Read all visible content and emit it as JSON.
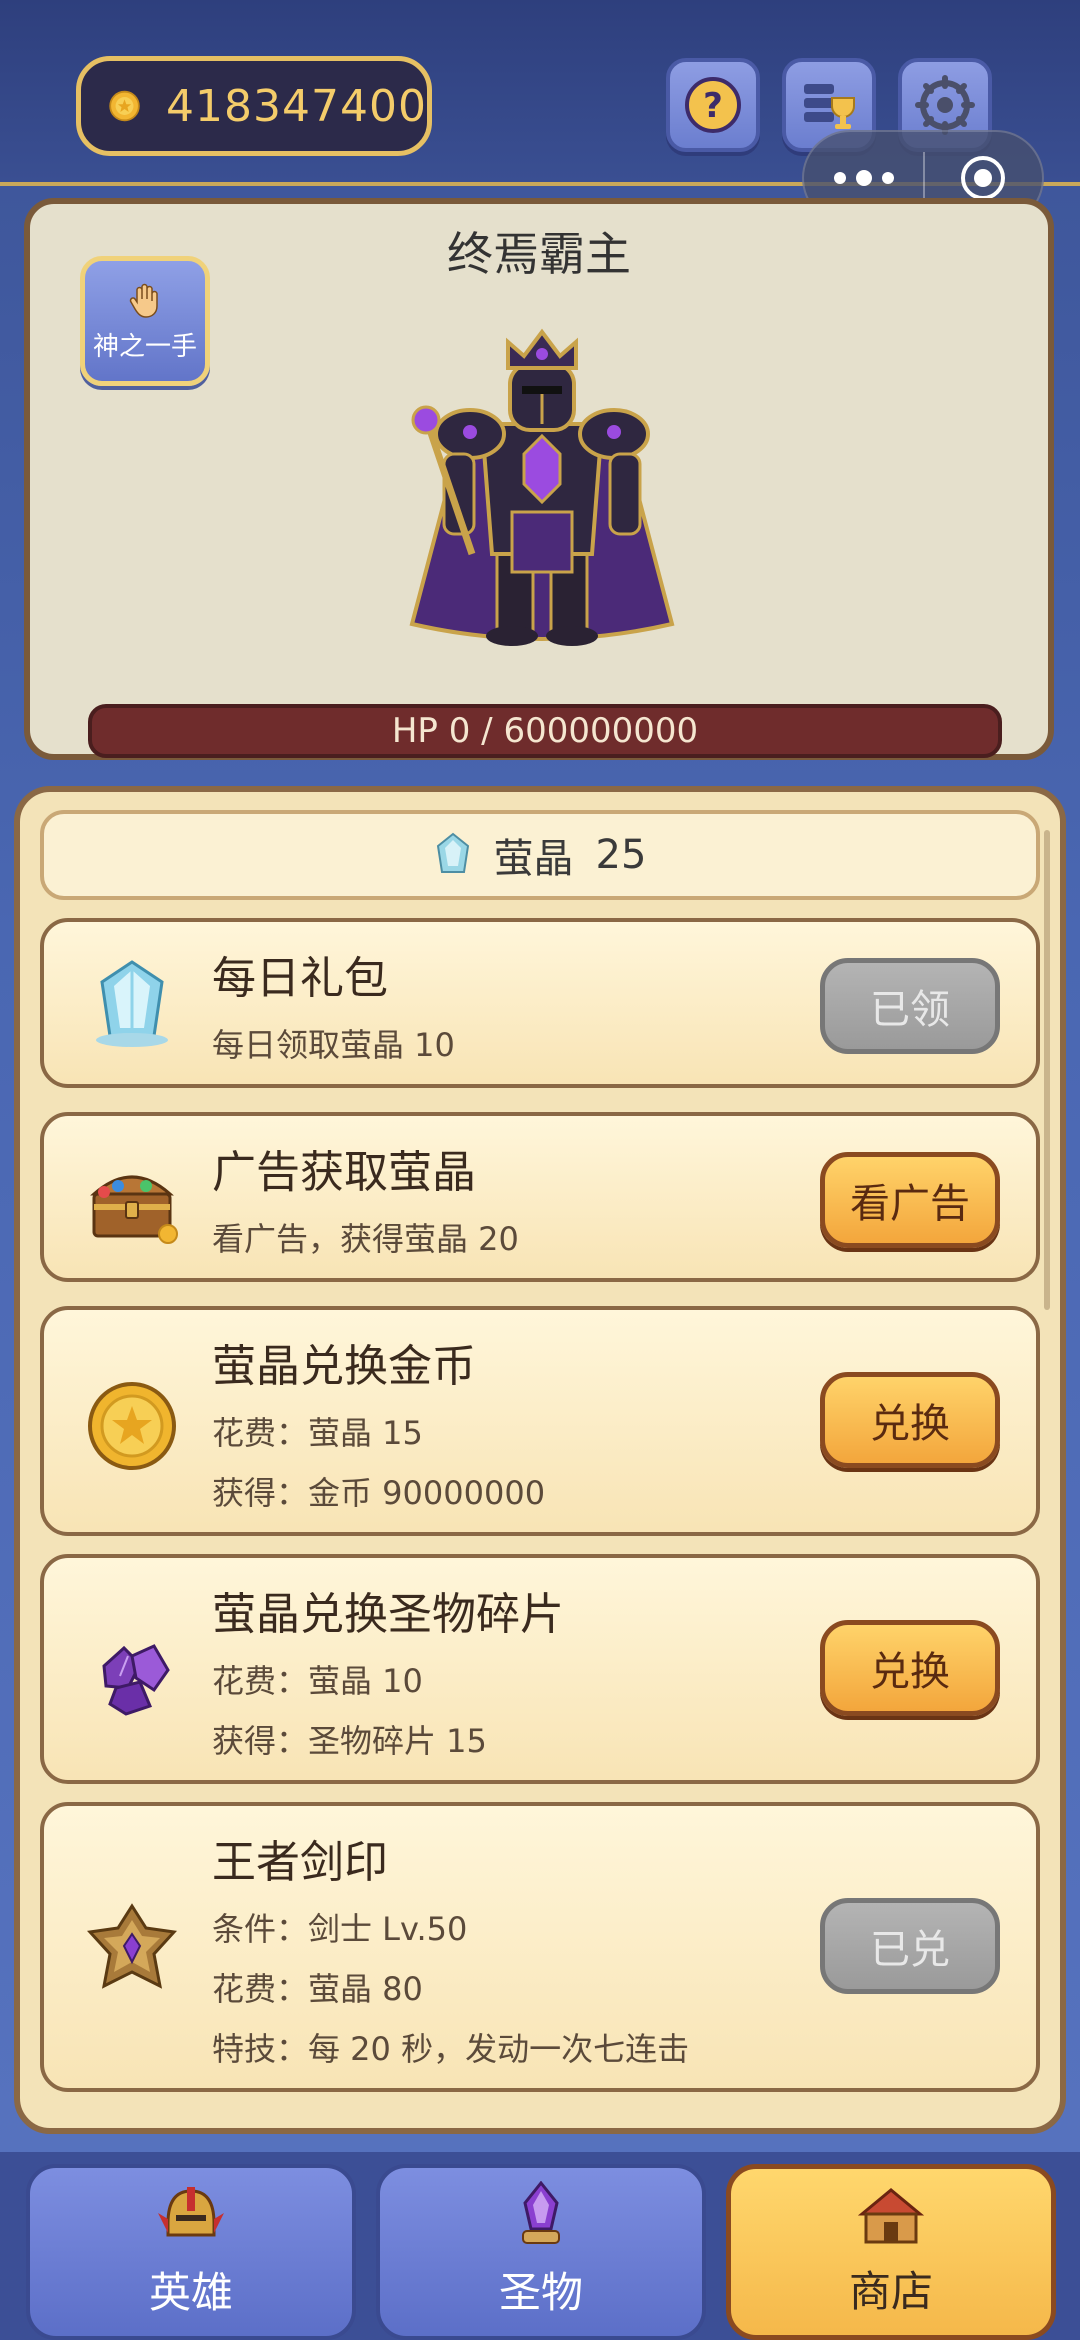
{
  "topbar": {
    "gold_amount": "418347400",
    "icons": [
      "coin-icon",
      "help-icon",
      "ranking-icon",
      "settings-icon"
    ]
  },
  "boss": {
    "name": "终焉霸主",
    "skill_label": "神之一手",
    "hp_text": "HP 0 / 600000000",
    "hp_fraction": 0
  },
  "shop": {
    "currency_label": "萤晶",
    "currency_value": "25",
    "items": [
      {
        "title": "每日礼包",
        "lines": [
          "每日领取萤晶 10"
        ],
        "button": "已领",
        "state": "disabled",
        "icon": "crystal-icon"
      },
      {
        "title": "广告获取萤晶",
        "lines": [
          "看广告，获得萤晶 20"
        ],
        "button": "看广告",
        "state": "active",
        "icon": "treasure-chest-icon"
      },
      {
        "title": "萤晶兑换金币",
        "lines": [
          "花费：萤晶 15",
          "获得：金币 90000000"
        ],
        "button": "兑换",
        "state": "active",
        "icon": "gold-coin-icon"
      },
      {
        "title": "萤晶兑换圣物碎片",
        "lines": [
          "花费：萤晶 10",
          "获得：圣物碎片 15"
        ],
        "button": "兑换",
        "state": "active",
        "icon": "relic-shard-icon"
      },
      {
        "title": "王者剑印",
        "lines": [
          "条件：剑士 Lv.50",
          "花费：萤晶 80",
          "特技：每 20 秒，发动一次七连击"
        ],
        "button": "已兑",
        "state": "disabled",
        "icon": "sword-seal-icon"
      }
    ]
  },
  "nav": {
    "tabs": [
      {
        "label": "英雄",
        "icon": "hero-helmet-icon",
        "active": false
      },
      {
        "label": "圣物",
        "icon": "relic-crystal-icon",
        "active": false
      },
      {
        "label": "商店",
        "icon": "shop-tent-icon",
        "active": true
      }
    ]
  },
  "colors": {
    "accent_gold": "#e6c063",
    "button_orange": "#f3a63c",
    "hp_bar": "#6f2c2c",
    "panel_cream": "#f3e3b8"
  }
}
